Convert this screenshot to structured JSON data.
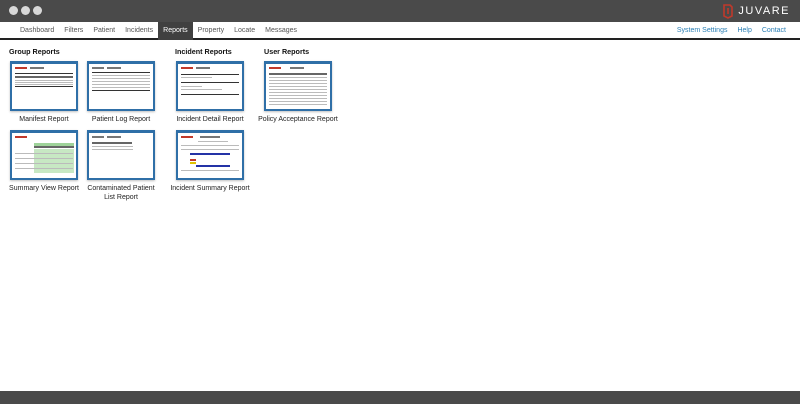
{
  "titlebar": {
    "brand": "JUVARE",
    "colors": {
      "bar": "#4a4a4a",
      "logo_accent": "#c0392b"
    }
  },
  "nav": {
    "items": [
      {
        "label": "Dashboard",
        "active": false
      },
      {
        "label": "Filters",
        "active": false
      },
      {
        "label": "Patient",
        "active": false
      },
      {
        "label": "Incidents",
        "active": false
      },
      {
        "label": "Reports",
        "active": true
      },
      {
        "label": "Property",
        "active": false
      },
      {
        "label": "Locate",
        "active": false
      },
      {
        "label": "Messages",
        "active": false
      }
    ],
    "right_links": [
      {
        "label": "System Settings"
      },
      {
        "label": "Help"
      },
      {
        "label": "Contact"
      }
    ]
  },
  "sections": {
    "group": {
      "title": "Group Reports"
    },
    "incident": {
      "title": "Incident Reports"
    },
    "user": {
      "title": "User Reports"
    }
  },
  "reports": {
    "manifest": {
      "label": "Manifest Report"
    },
    "patient_log": {
      "label": "Patient Log Report"
    },
    "summary_view": {
      "label": "Summary View Report"
    },
    "contaminated": {
      "label": "Contaminated Patient List Report"
    },
    "incident_detail": {
      "label": "Incident Detail Report"
    },
    "incident_summary": {
      "label": "Incident Summary Report"
    },
    "policy_acceptance": {
      "label": "Policy Acceptance Report"
    }
  },
  "colors": {
    "link": "#2a7fb5",
    "thumb_border": "#2f6fa7",
    "active_tab": "#404040"
  }
}
